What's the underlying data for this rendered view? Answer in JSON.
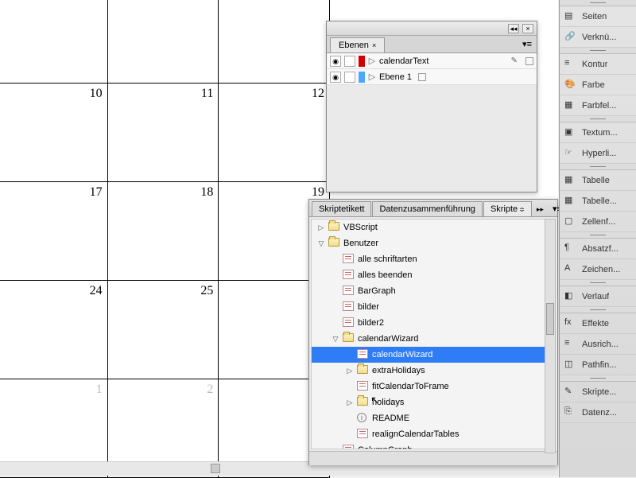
{
  "calendar": {
    "rows": [
      [
        "",
        "",
        ""
      ],
      [
        "10",
        "11",
        "12"
      ],
      [
        "17",
        "18",
        "19"
      ],
      [
        "24",
        "25",
        ""
      ],
      [
        "1",
        "2",
        ""
      ]
    ],
    "dim_row": 4
  },
  "layers_panel": {
    "tab_label": "Ebenen",
    "layers": [
      {
        "name": "calendarText",
        "color": "#d40000",
        "pen": true
      },
      {
        "name": "Ebene 1",
        "color": "#4da6ff",
        "pen": false
      }
    ]
  },
  "scripts_panel": {
    "tabs": {
      "etikett": "Skriptetikett",
      "daten": "Datenzusammenführung",
      "skripte": "Skripte"
    },
    "tree": [
      {
        "depth": 0,
        "tw": "▷",
        "type": "folder",
        "label": "VBScript"
      },
      {
        "depth": 0,
        "tw": "▽",
        "type": "folder",
        "label": "Benutzer"
      },
      {
        "depth": 1,
        "tw": "",
        "type": "script",
        "label": "alle schriftarten"
      },
      {
        "depth": 1,
        "tw": "",
        "type": "script",
        "label": "alles beenden"
      },
      {
        "depth": 1,
        "tw": "",
        "type": "script",
        "label": "BarGraph"
      },
      {
        "depth": 1,
        "tw": "",
        "type": "script",
        "label": "bilder"
      },
      {
        "depth": 1,
        "tw": "",
        "type": "script",
        "label": "bilder2"
      },
      {
        "depth": 1,
        "tw": "▽",
        "type": "folder",
        "label": "calendarWizard"
      },
      {
        "depth": 2,
        "tw": "",
        "type": "script",
        "label": "calendarWizard",
        "selected": true
      },
      {
        "depth": 2,
        "tw": "▷",
        "type": "folder",
        "label": "extraHolidays"
      },
      {
        "depth": 2,
        "tw": "",
        "type": "script",
        "label": "fitCalendarToFrame"
      },
      {
        "depth": 2,
        "tw": "▷",
        "type": "folder",
        "label": "holidays"
      },
      {
        "depth": 2,
        "tw": "",
        "type": "info",
        "label": "README"
      },
      {
        "depth": 2,
        "tw": "",
        "type": "script",
        "label": "realignCalendarTables"
      },
      {
        "depth": 1,
        "tw": "",
        "type": "script",
        "label": "ColumnGraph"
      }
    ]
  },
  "right_panels": [
    [
      {
        "label": "Seiten",
        "icon": "pages"
      },
      {
        "label": "Verknü...",
        "icon": "links"
      }
    ],
    [
      {
        "label": "Kontur",
        "icon": "stroke"
      },
      {
        "label": "Farbe",
        "icon": "color"
      },
      {
        "label": "Farbfel...",
        "icon": "swatches"
      }
    ],
    [
      {
        "label": "Textum...",
        "icon": "textwrap"
      },
      {
        "label": "Hyperli...",
        "icon": "hyperlink"
      }
    ],
    [
      {
        "label": "Tabelle",
        "icon": "table"
      },
      {
        "label": "Tabelle...",
        "icon": "tablestyles"
      },
      {
        "label": "Zellenf...",
        "icon": "cellstyles"
      }
    ],
    [
      {
        "label": "Absatzf...",
        "icon": "para"
      },
      {
        "label": "Zeichen...",
        "icon": "char"
      }
    ],
    [
      {
        "label": "Verlauf",
        "icon": "gradient"
      }
    ],
    [
      {
        "label": "Effekte",
        "icon": "fx"
      },
      {
        "label": "Ausrich...",
        "icon": "align"
      },
      {
        "label": "Pathfin...",
        "icon": "pathfinder"
      }
    ],
    [
      {
        "label": "Skripte...",
        "icon": "scripts"
      },
      {
        "label": "Datenz...",
        "icon": "datamerge"
      }
    ]
  ],
  "icons": {
    "pages": "▤",
    "links": "🔗",
    "stroke": "≡",
    "color": "🎨",
    "swatches": "▦",
    "textwrap": "▣",
    "hyperlink": "☞",
    "table": "▦",
    "tablestyles": "▦",
    "cellstyles": "▢",
    "para": "¶",
    "char": "A",
    "gradient": "◧",
    "fx": "fx",
    "align": "≡",
    "pathfinder": "◫",
    "scripts": "✎",
    "datamerge": "⎘"
  }
}
